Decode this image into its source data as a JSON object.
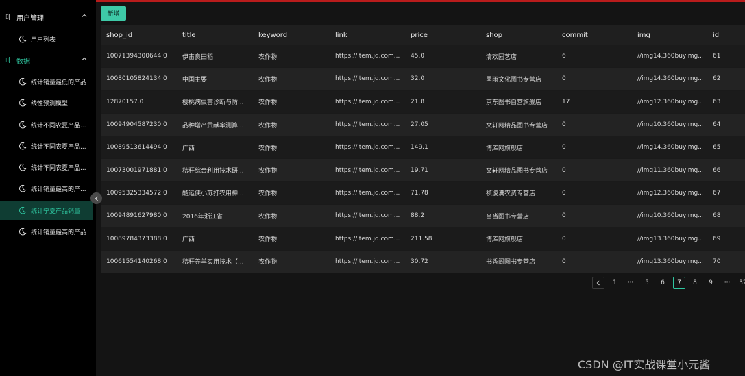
{
  "sidebar": {
    "groups": [
      {
        "label": "用户管理",
        "items": [
          {
            "label": "用户列表"
          }
        ]
      },
      {
        "label": "数据",
        "items": [
          {
            "label": "统计销量最低的产品"
          },
          {
            "label": "线性预测模型"
          },
          {
            "label": "统计不同农夏产品..."
          },
          {
            "label": "统计不同农夏产品..."
          },
          {
            "label": "统计不同农夏产品..."
          },
          {
            "label": "统计销量最高的产..."
          },
          {
            "label": "统计宁夏产品销量"
          },
          {
            "label": "统计销量最高的产品"
          }
        ]
      }
    ],
    "selected_item": "统计宁夏产品销量",
    "active_color": "#2fc6a0"
  },
  "toolbar": {
    "add_label": "新增"
  },
  "table": {
    "columns": [
      "shop_id",
      "title",
      "keyword",
      "link",
      "price",
      "shop",
      "commit",
      "img",
      "id"
    ],
    "rows": [
      [
        "10071394300644.0",
        "伊宙良田稻",
        "农作物",
        "https://item.jd.com...",
        "45.0",
        "清欢园艺店",
        "6",
        "//img14.360buyimg...",
        "61"
      ],
      [
        "10080105824134.0",
        "中国主要",
        "农作物",
        "https://item.jd.com...",
        "32.0",
        "墨雨文化图书专营店",
        "0",
        "//img14.360buyimg...",
        "62"
      ],
      [
        "12870157.0",
        "樱桃病虫害诊断与防...",
        "农作物",
        "https://item.jd.com...",
        "21.8",
        "京东图书自营旗舰店",
        "17",
        "//img12.360buyimg...",
        "63"
      ],
      [
        "10094904587230.0",
        "品种增产贡献率测算...",
        "农作物",
        "https://item.jd.com...",
        "27.05",
        "文轩网精品图书专营店",
        "0",
        "//img10.360buyimg...",
        "64"
      ],
      [
        "10089513614494.0",
        "广西",
        "农作物",
        "https://item.jd.com...",
        "149.1",
        "博库网旗舰店",
        "0",
        "//img14.360buyimg...",
        "65"
      ],
      [
        "10073001971881.0",
        "秸秆综合利用技术研...",
        "农作物",
        "https://item.jd.com...",
        "19.71",
        "文轩网精品图书专营店",
        "0",
        "//img11.360buyimg...",
        "66"
      ],
      [
        "10095325334572.0",
        "酷运侠小苏打农用神...",
        "农作物",
        "https://item.jd.com...",
        "71.78",
        "祯凌满农资专营店",
        "0",
        "//img12.360buyimg...",
        "67"
      ],
      [
        "10094891627980.0",
        "2016年浙江省",
        "农作物",
        "https://item.jd.com...",
        "88.2",
        "当当图书专营店",
        "0",
        "//img10.360buyimg...",
        "68"
      ],
      [
        "10089784373388.0",
        "广西",
        "农作物",
        "https://item.jd.com...",
        "211.58",
        "博库网旗舰店",
        "0",
        "//img13.360buyimg...",
        "69"
      ],
      [
        "10061554140268.0",
        "秸秆养羊实用技术【...",
        "农作物",
        "https://item.jd.com...",
        "30.72",
        "书香阁图书专营店",
        "0",
        "//img13.360buyimg...",
        "70"
      ]
    ]
  },
  "pagination": {
    "items": [
      "1",
      "···",
      "5",
      "6",
      "7",
      "8",
      "9",
      "···",
      "32"
    ],
    "current": "7"
  },
  "watermark": "CSDN @IT实战课堂小元酱"
}
